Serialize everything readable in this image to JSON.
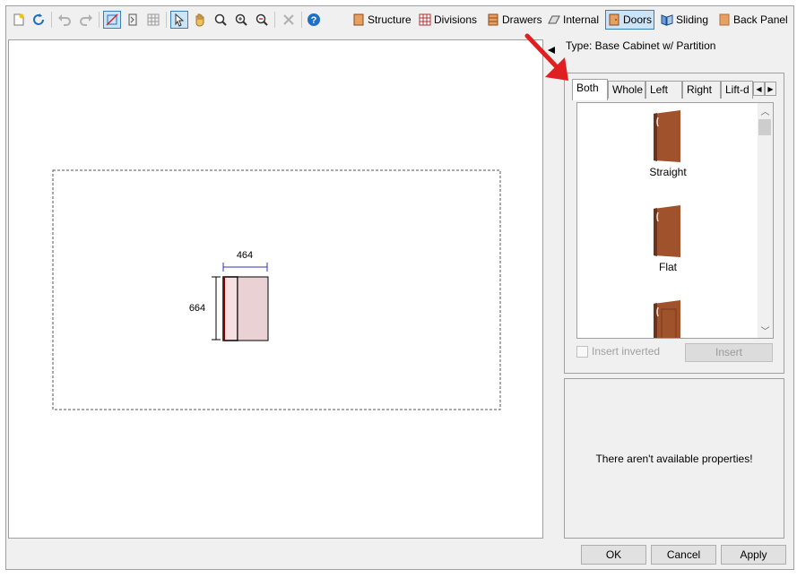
{
  "toolbar": {
    "icons": [
      "new-icon",
      "refresh-icon",
      "undo-icon",
      "redo-icon",
      "erase-icon",
      "bracket-icon",
      "grid-icon",
      "pointer-icon",
      "pan-icon",
      "zoom-window-icon",
      "zoom-in-icon",
      "zoom-out-icon",
      "delete-icon",
      "help-icon"
    ],
    "structure": "Structure",
    "divisions": "Divisions",
    "drawers": "Drawers",
    "internal": "Internal",
    "doors": "Doors",
    "sliding": "Sliding",
    "back_panel": "Back Panel"
  },
  "type_label": "Type: Base Cabinet w/ Partition",
  "drawing": {
    "width_dim": "464",
    "height_dim": "664"
  },
  "door_panel": {
    "tabs": [
      "Both",
      "Whole",
      "Left",
      "Right",
      "Lift-d"
    ],
    "selected_tab": "Both",
    "items": [
      {
        "label": "Straight"
      },
      {
        "label": "Flat"
      }
    ],
    "insert_inverted": "Insert inverted",
    "insert_button": "Insert"
  },
  "properties_message": "There aren't available properties!",
  "buttons": {
    "ok": "OK",
    "cancel": "Cancel",
    "apply": "Apply"
  },
  "colors": {
    "accent": "#3c7fb1",
    "arrow": "#e02020",
    "door": "#a0522d",
    "cabinet_fill": "#f4d6d8"
  }
}
